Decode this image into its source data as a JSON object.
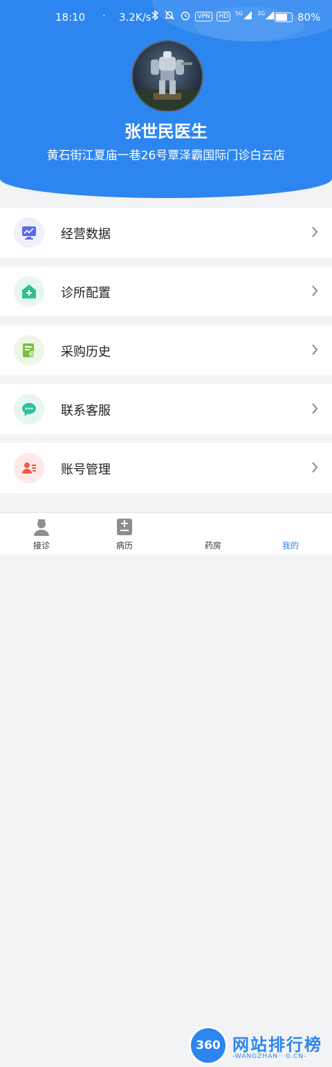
{
  "status_bar": {
    "time": "18:10",
    "dot": "·",
    "speed": "3.2K/s",
    "vpn": "VPN",
    "hd": "HD",
    "net1": "5G",
    "net2": "3G",
    "battery": "80%",
    "battery_level": 0.8
  },
  "profile": {
    "name": "张世民医生",
    "address": "黄石街江夏庙一巷26号覃泽霸国际门诊白云店"
  },
  "menu": [
    {
      "label": "经营数据",
      "icon": "monitor-chart-icon",
      "bg": "#eef0fb",
      "color": "#5b6be8"
    },
    {
      "label": "诊所配置",
      "icon": "clinic-house-icon",
      "bg": "#e6f7f2",
      "color": "#2fc08f"
    },
    {
      "label": "采购历史",
      "icon": "document-search-icon",
      "bg": "#eef7e6",
      "color": "#7bc043"
    },
    {
      "label": "联系客服",
      "icon": "chat-bubble-icon",
      "bg": "#e6f7f2",
      "color": "#2fc0a0"
    },
    {
      "label": "账号管理",
      "icon": "user-card-icon",
      "bg": "#fde9e7",
      "color": "#ef5a45"
    }
  ],
  "tabs": [
    {
      "label": "接诊"
    },
    {
      "label": "病历"
    },
    {
      "label": "药房"
    },
    {
      "label": "我的"
    }
  ],
  "watermark": {
    "badge": "360",
    "title": "网站排行榜",
    "url": "-WANGZHAN···0.CN-"
  },
  "colors": {
    "header": "#2d86f0",
    "chevron": "#888888"
  }
}
